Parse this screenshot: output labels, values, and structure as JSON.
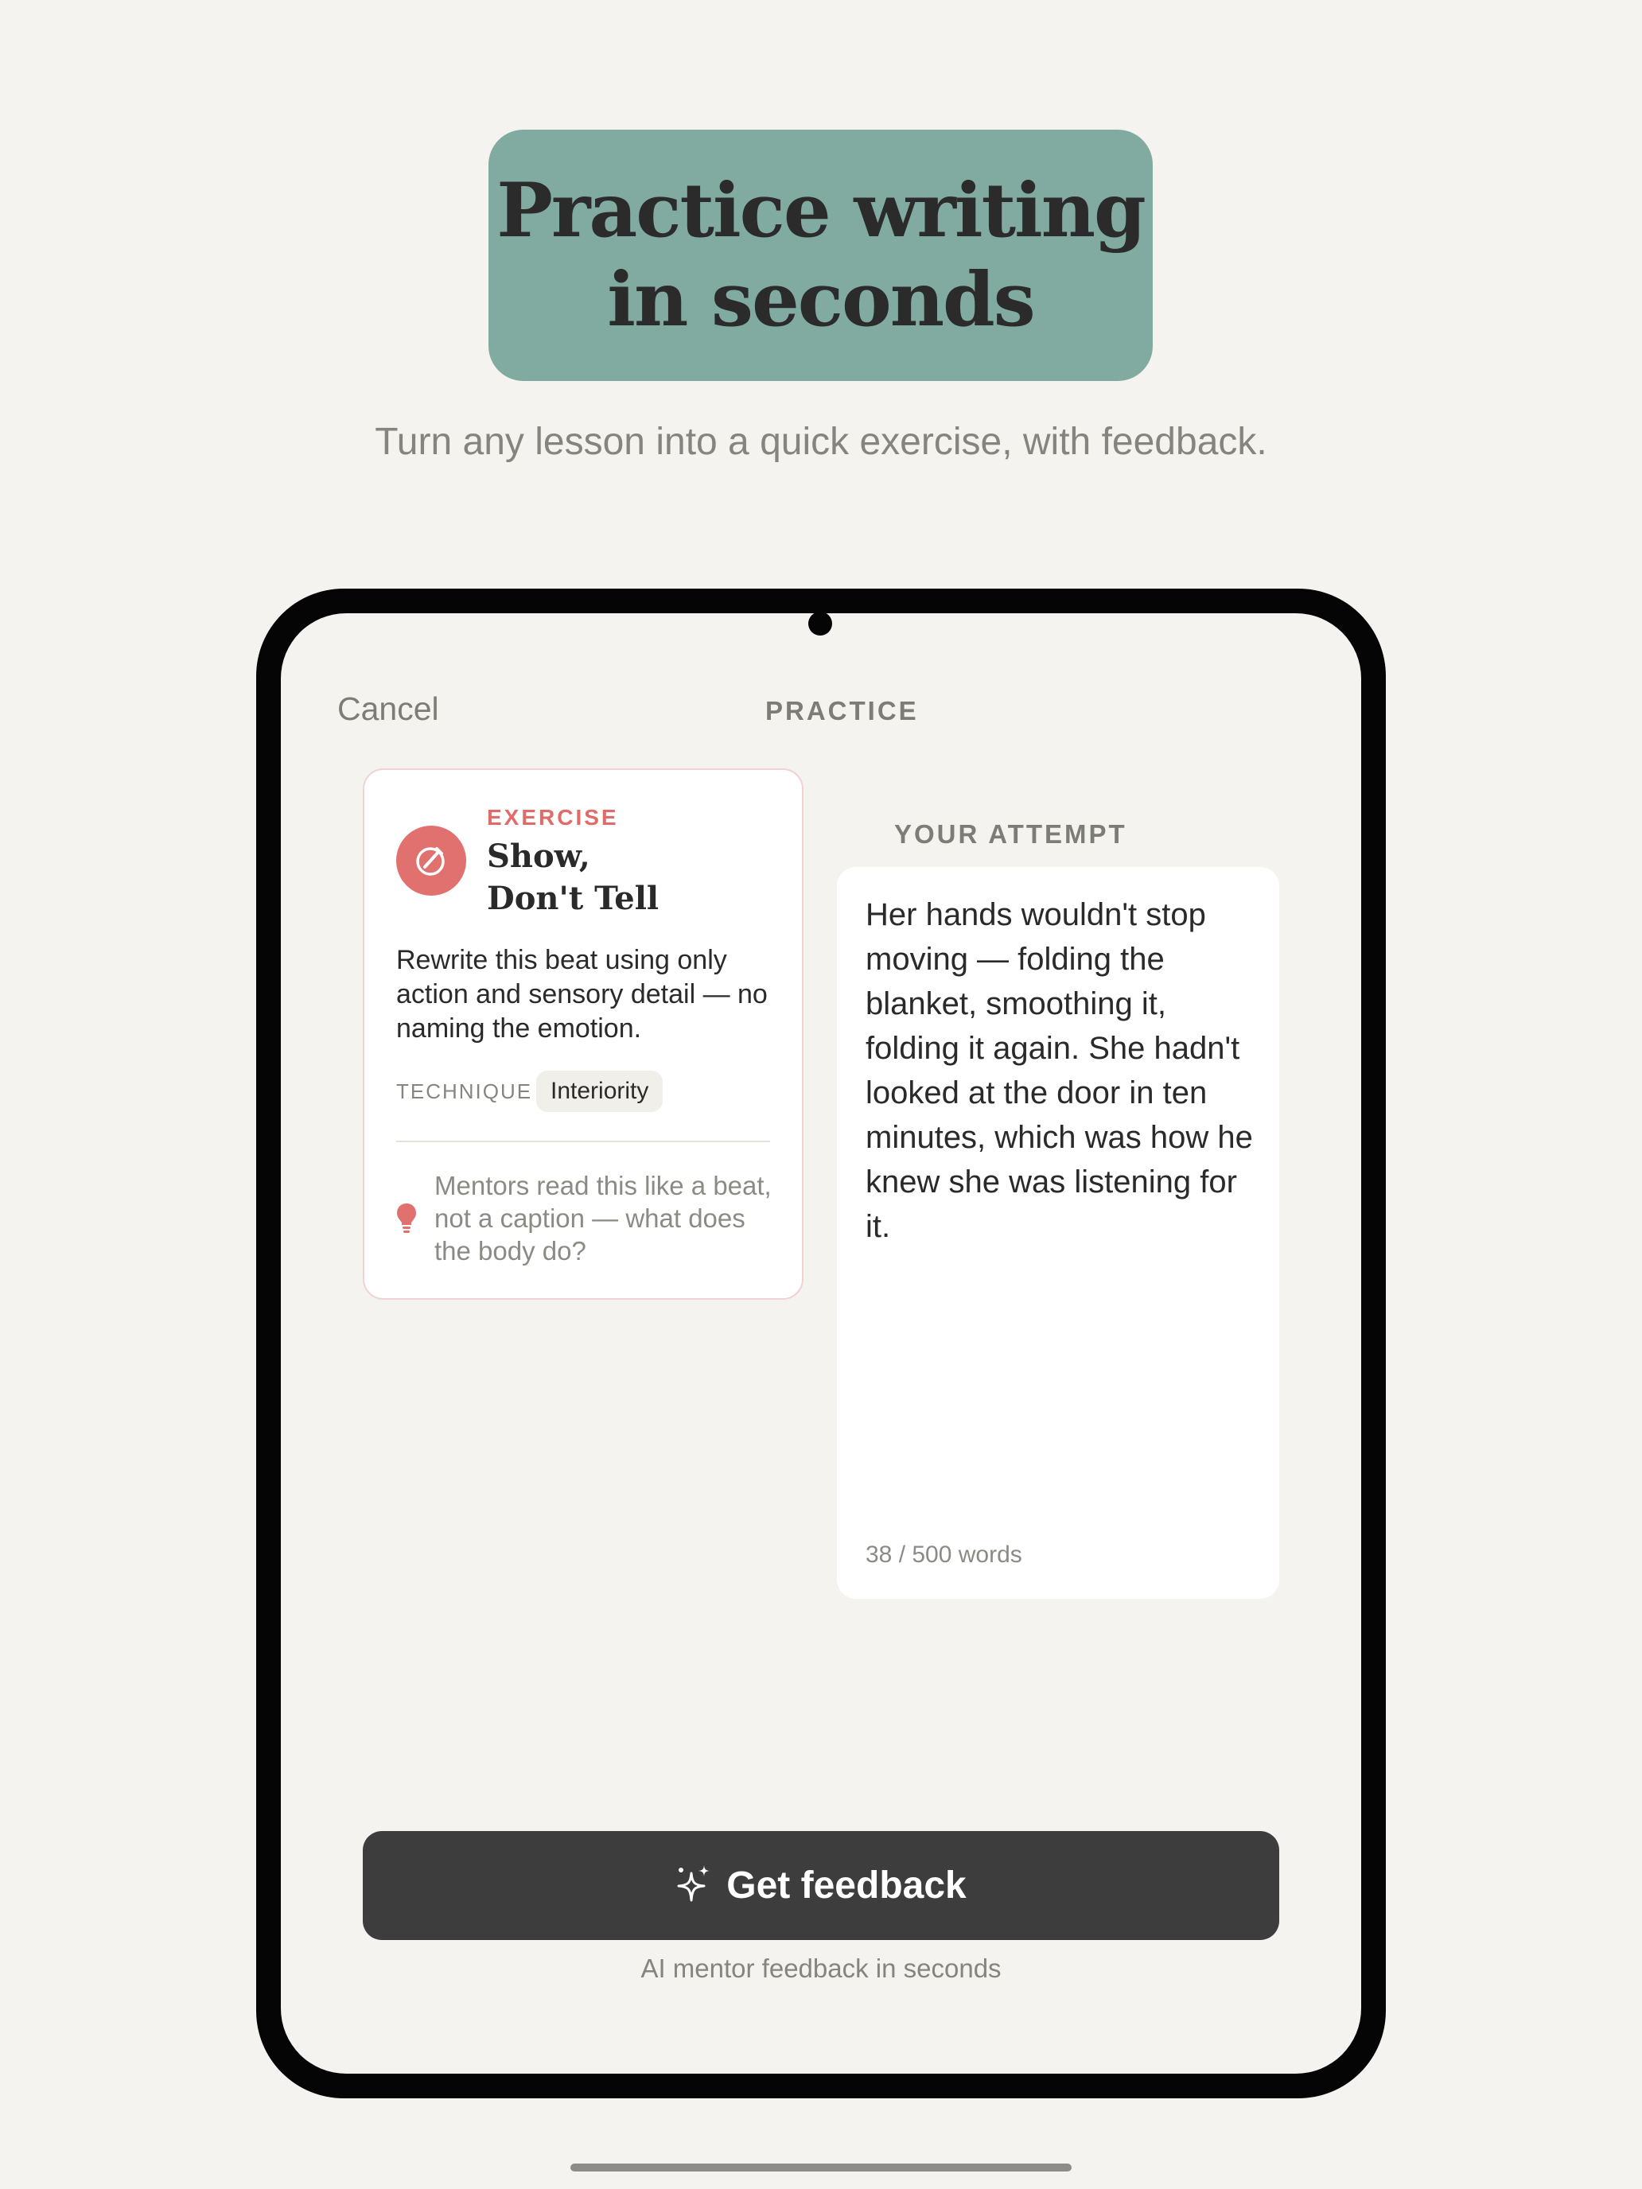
{
  "headline": {
    "line1": "Practice writing",
    "line2": "in seconds"
  },
  "subtitle": "Turn any lesson into a quick exercise, with feedback.",
  "nav": {
    "cancel_label": "Cancel",
    "title": "PRACTICE"
  },
  "exercise": {
    "label": "EXERCISE",
    "title_line1": "Show,",
    "title_line2": "Don't Tell",
    "description": "Rewrite this beat using only action and sensory detail — no naming the emotion.",
    "technique_label": "TECHNIQUE",
    "technique_value": "Interiority",
    "tip": "Mentors read this like a beat, not a caption — what does the body do?",
    "icon": "pen-circle-icon",
    "tip_icon": "lightbulb-icon"
  },
  "attempt": {
    "label": "YOUR ATTEMPT",
    "text": "Her hands wouldn't stop moving — folding the blanket, smoothing it, folding it again. She hadn't looked at the door in ten minutes, which was how he knew she was listening for it.",
    "word_count": "38 / 500 words"
  },
  "action": {
    "button_label": "Get feedback",
    "button_icon": "sparkle-icon",
    "caption": "AI mentor feedback in seconds"
  },
  "colors": {
    "background": "#f4f3ef",
    "headline_bg": "#81aaa0",
    "accent": "#e0716f",
    "button_bg": "#3d3d3d"
  }
}
